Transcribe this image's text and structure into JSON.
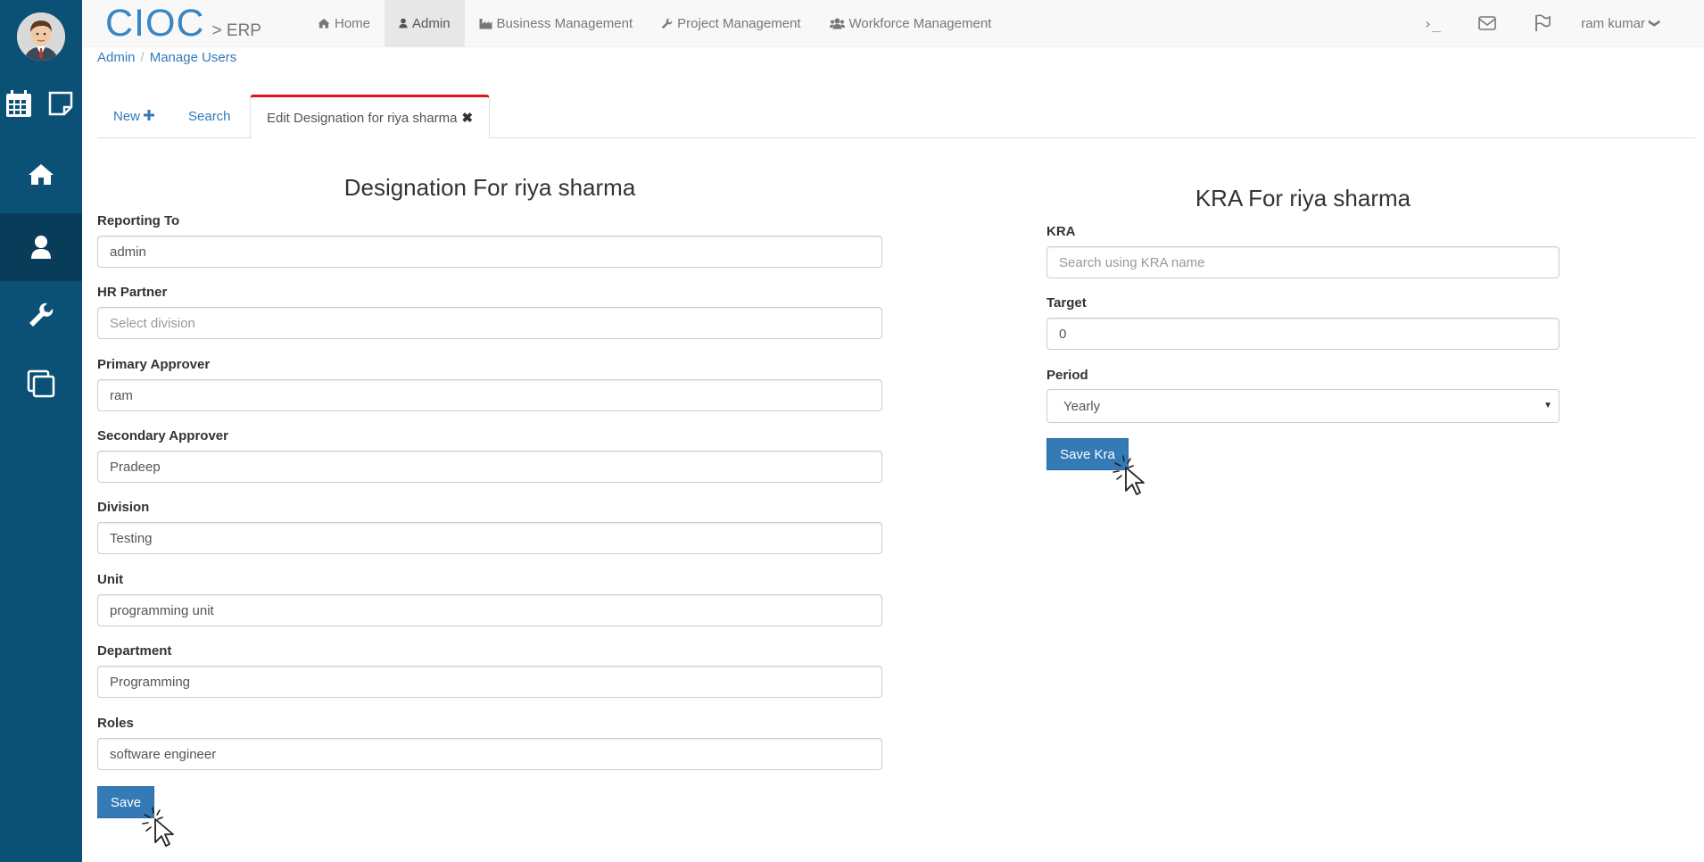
{
  "brand": {
    "name": "CIOC",
    "separator": ">",
    "sub": "ERP"
  },
  "nav": {
    "items": [
      {
        "icon": "home-icon",
        "label": "Home"
      },
      {
        "icon": "user-icon",
        "label": "Admin"
      },
      {
        "icon": "industry-icon",
        "label": "Business Management"
      },
      {
        "icon": "wrench-icon",
        "label": "Project Management"
      },
      {
        "icon": "users-icon",
        "label": "Workforce Management"
      }
    ],
    "active_index": 1,
    "terminal_glyph": "›_",
    "user_name": "ram kumar",
    "user_chevron": "❯"
  },
  "sidebar": {
    "items": [
      {
        "icon": "calendar-icon"
      },
      {
        "icon": "sticky-note-icon"
      },
      {
        "icon": "home-icon"
      },
      {
        "icon": "user-icon",
        "active": true
      },
      {
        "icon": "wrench-icon"
      },
      {
        "icon": "copy-icon"
      }
    ]
  },
  "breadcrumb": {
    "items": [
      "Admin",
      "Manage Users"
    ],
    "separator": "/"
  },
  "tabs": {
    "new_label": "New",
    "new_icon": "plus-icon",
    "search_label": "Search",
    "edit_label": "Edit Designation for riya sharma",
    "edit_close_glyph": "✖"
  },
  "designation_form": {
    "title": "Designation For riya sharma",
    "fields": [
      {
        "label": "Reporting To",
        "value": "admin",
        "placeholder": ""
      },
      {
        "label": "HR Partner",
        "value": "",
        "placeholder": "Select division"
      },
      {
        "label": "Primary Approver",
        "value": "ram",
        "placeholder": ""
      },
      {
        "label": "Secondary Approver",
        "value": "Pradeep",
        "placeholder": ""
      },
      {
        "label": "Division",
        "value": "Testing",
        "placeholder": ""
      },
      {
        "label": "Unit",
        "value": "programming unit",
        "placeholder": ""
      },
      {
        "label": "Department",
        "value": "Programming",
        "placeholder": ""
      },
      {
        "label": "Roles",
        "value": "software engineer",
        "placeholder": ""
      }
    ],
    "save_label": "Save"
  },
  "kra_form": {
    "title": "KRA For riya sharma",
    "kra_label": "KRA",
    "kra_placeholder": "Search using KRA name",
    "kra_value": "",
    "target_label": "Target",
    "target_value": "0",
    "period_label": "Period",
    "period_value": "Yearly",
    "period_caret": "▼",
    "save_label": "Save Kra"
  },
  "colors": {
    "sidebar_bg": "#0b5075",
    "sidebar_active": "#093c58",
    "brand_blue": "#3a86c2",
    "link_blue": "#337ab7",
    "primary_button": "#337ab7",
    "active_tab_border": "#e0161f"
  }
}
